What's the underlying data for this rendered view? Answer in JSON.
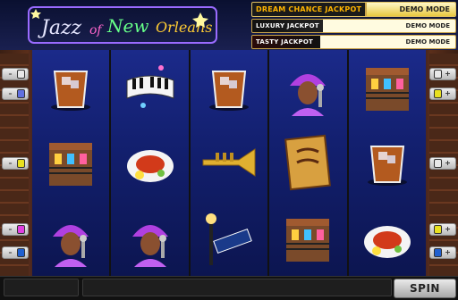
{
  "logo": {
    "word1": "Jazz",
    "word2": "of",
    "word3": "New",
    "word4": "Orleans"
  },
  "jackpots": [
    {
      "name": "DREAM CHANCE JACKPOT",
      "value": "DEMO MODE",
      "kind": "main"
    },
    {
      "name": "LUXURY JACKPOT",
      "value": "DEMO MODE",
      "kind": "luxury"
    },
    {
      "name": "TASTY JACKPOT",
      "value": "DEMO MODE",
      "kind": "tasty"
    }
  ],
  "reels": [
    [
      "whiskey-glass-icon",
      "balcony-house-icon",
      "jazz-singer-icon"
    ],
    [
      "piano-keys-icon",
      "crawfish-plate-icon",
      "jazz-singer-icon"
    ],
    [
      "whiskey-glass-icon",
      "trumpet-icon",
      "street-sign-icon"
    ],
    [
      "jazz-singer-icon",
      "jazz-poster-icon",
      "balcony-house-icon"
    ],
    [
      "balcony-house-icon",
      "whiskey-glass-icon",
      "crawfish-plate-icon"
    ]
  ],
  "spin_label": "SPIN",
  "colors": {
    "gold": "#ffb400",
    "reel_blue": "#132070"
  }
}
